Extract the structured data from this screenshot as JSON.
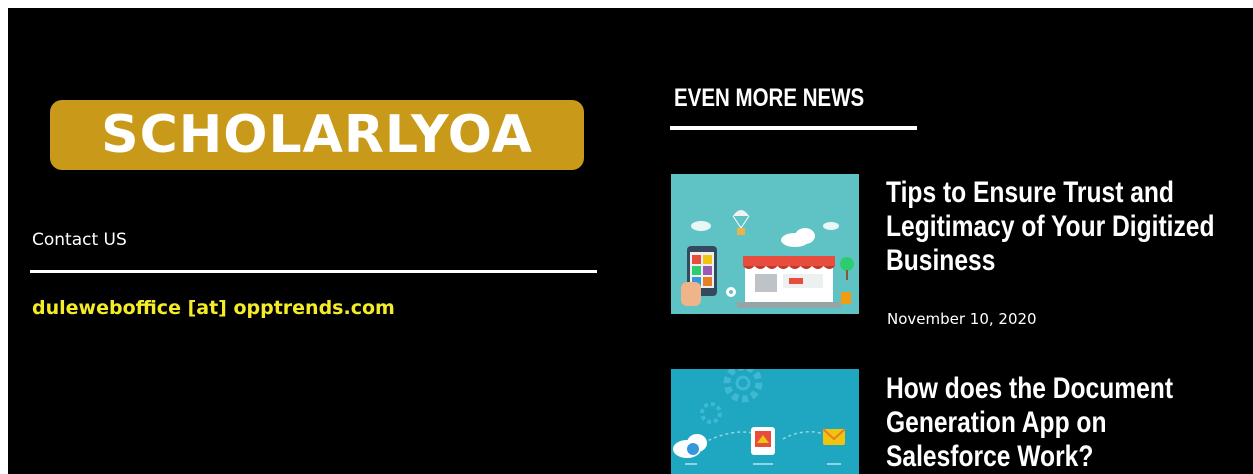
{
  "site": {
    "logo_text": "SCHOLARLYOA",
    "logo_color": "#c9991a"
  },
  "contact": {
    "title": "Contact US",
    "email": "duleweboffice [at] opptrends.com",
    "email_color": "#f4ec27"
  },
  "news": {
    "heading": "EVEN MORE NEWS",
    "articles": [
      {
        "title": "Tips to Ensure Trust and Legitimacy of Your Digitized Business",
        "date": "November 10, 2020",
        "thumbnail": "online-shop-illustration"
      },
      {
        "title": "How does the Document Generation App on Salesforce Work?",
        "thumbnail": "document-generation-illustration"
      }
    ]
  }
}
